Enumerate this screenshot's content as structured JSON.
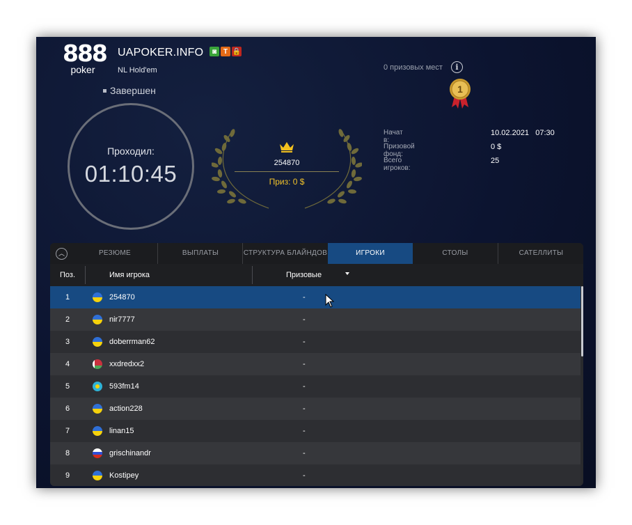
{
  "logo": {
    "number": "888",
    "word": "poker"
  },
  "tournament": {
    "title": "UAPOKER.INFO",
    "game": "NL Hold'em",
    "badges": [
      {
        "label": "◙",
        "color": "#3aa43a"
      },
      {
        "label": "T",
        "color": "#e36a17"
      },
      {
        "label": "🔒",
        "color": "#c0271e"
      }
    ],
    "status": "Завершен"
  },
  "clock": {
    "label": "Проходил:",
    "time": "01:10:45"
  },
  "winner": {
    "name": "254870",
    "prize": "Приз: 0 $"
  },
  "prize_places": "0 призовых мест",
  "medal_number": "1",
  "stats": [
    {
      "key": "Начат в:",
      "value": "10.02.2021   07:30"
    },
    {
      "key": "Призовой фонд:",
      "value": "0 $"
    },
    {
      "key": "Всего игроков:",
      "value": "25"
    }
  ],
  "tabs": [
    "РЕЗЮМЕ",
    "ВЫПЛАТЫ",
    "СТРУКТУРА БЛАЙНДОВ",
    "ИГРОКИ",
    "СТОЛЫ",
    "САТЕЛЛИТЫ"
  ],
  "active_tab": "ИГРОКИ",
  "table": {
    "headers": {
      "pos": "Поз.",
      "name": "Имя игрока",
      "prize": "Призовые"
    },
    "rows": [
      {
        "pos": "1",
        "flag": "ua",
        "name": "254870",
        "prize": "-"
      },
      {
        "pos": "2",
        "flag": "ua",
        "name": "nir7777",
        "prize": "-"
      },
      {
        "pos": "3",
        "flag": "ua",
        "name": "doberrman62",
        "prize": "-"
      },
      {
        "pos": "4",
        "flag": "by",
        "name": "xxdredxx2",
        "prize": "-"
      },
      {
        "pos": "5",
        "flag": "kz",
        "name": "593fm14",
        "prize": "-"
      },
      {
        "pos": "6",
        "flag": "ua",
        "name": "action228",
        "prize": "-"
      },
      {
        "pos": "7",
        "flag": "ua",
        "name": "linan15",
        "prize": "-"
      },
      {
        "pos": "8",
        "flag": "ru",
        "name": "grischinandr",
        "prize": "-"
      },
      {
        "pos": "9",
        "flag": "ua",
        "name": "Kostipey",
        "prize": "-"
      }
    ],
    "selected_row": 0
  },
  "icons": {
    "info": "info-icon",
    "collapse": "chevron-up-icon",
    "sort": "sort-down-icon",
    "crown": "crown-icon",
    "medal": "medal-icon"
  },
  "colors": {
    "accent": "#174a82",
    "gold": "#f1c22a"
  }
}
